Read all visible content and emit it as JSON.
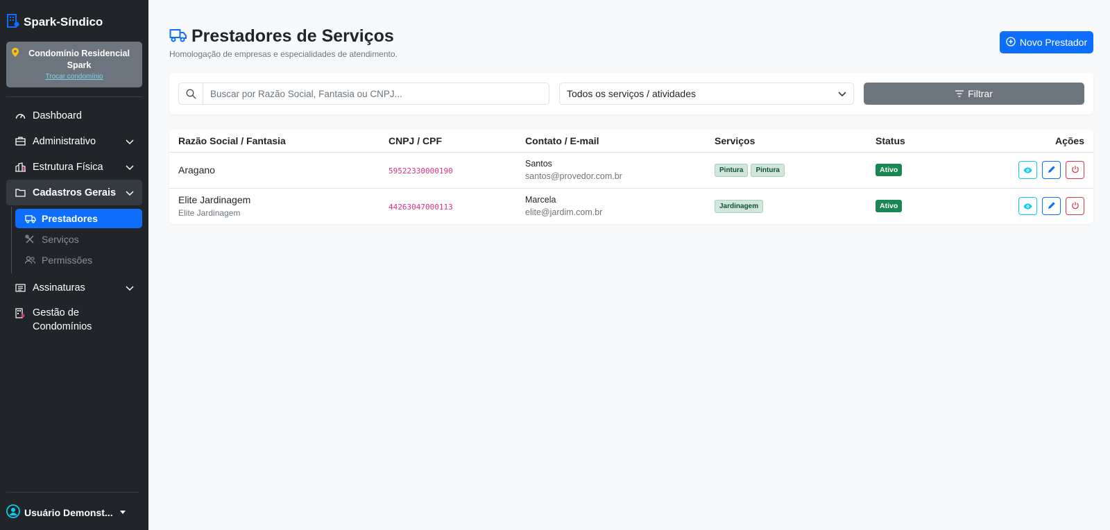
{
  "brand": {
    "name": "Spark-Síndico"
  },
  "condo": {
    "name": "Condomínio Residencial Spark",
    "switch_label": "Trocar condomínio"
  },
  "sidebar": {
    "items": [
      {
        "label": "Dashboard",
        "icon": "speedometer-icon"
      },
      {
        "label": "Administrativo",
        "icon": "briefcase-icon"
      },
      {
        "label": "Estrutura Física",
        "icon": "building-icon"
      },
      {
        "label": "Cadastros Gerais",
        "icon": "folder-icon"
      },
      {
        "label": "Assinaturas",
        "icon": "card-list-icon"
      },
      {
        "label": "Gestão de Condomínios",
        "icon": "buildings-icon"
      }
    ],
    "submenu": [
      {
        "label": "Prestadores",
        "icon": "truck-icon"
      },
      {
        "label": "Serviços",
        "icon": "tools-icon"
      },
      {
        "label": "Permissões",
        "icon": "people-icon"
      }
    ]
  },
  "user": {
    "name": "Usuário Demonst..."
  },
  "header": {
    "title": "Prestadores de Serviços",
    "subtitle": "Homologação de empresas e especialidades de atendimento.",
    "new_button": "Novo Prestador"
  },
  "filters": {
    "search_placeholder": "Buscar por Razão Social, Fantasia ou CNPJ...",
    "select_value": "Todos os serviços / atividades",
    "filter_button": "Filtrar"
  },
  "table": {
    "headers": [
      "Razão Social / Fantasia",
      "CNPJ / CPF",
      "Contato / E-mail",
      "Serviços",
      "Status",
      "Ações"
    ],
    "rows": [
      {
        "name": "Aragano",
        "fantasy": "",
        "cnpj": "59522330000190",
        "contact": "Santos",
        "email": "santos@provedor.com.br",
        "services": [
          "Pintura",
          "Pintura"
        ],
        "status": "Ativo"
      },
      {
        "name": "Elite Jardinagem",
        "fantasy": "Elite Jardinagem",
        "cnpj": "44263047000113",
        "contact": "Marcela",
        "email": "elite@jardim.com.br",
        "services": [
          "Jardinagem"
        ],
        "status": "Ativo"
      }
    ]
  },
  "colors": {
    "primary": "#0d6efd",
    "sidebar": "#212529",
    "success": "#198754",
    "secondary": "#6c757d"
  }
}
